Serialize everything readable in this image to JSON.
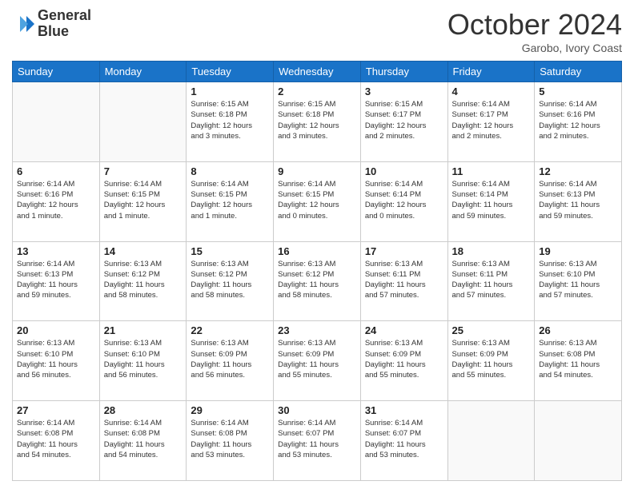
{
  "header": {
    "logo_line1": "General",
    "logo_line2": "Blue",
    "month": "October 2024",
    "location": "Garobo, Ivory Coast"
  },
  "weekdays": [
    "Sunday",
    "Monday",
    "Tuesday",
    "Wednesday",
    "Thursday",
    "Friday",
    "Saturday"
  ],
  "weeks": [
    [
      {
        "day": "",
        "info": ""
      },
      {
        "day": "",
        "info": ""
      },
      {
        "day": "1",
        "info": "Sunrise: 6:15 AM\nSunset: 6:18 PM\nDaylight: 12 hours\nand 3 minutes."
      },
      {
        "day": "2",
        "info": "Sunrise: 6:15 AM\nSunset: 6:18 PM\nDaylight: 12 hours\nand 3 minutes."
      },
      {
        "day": "3",
        "info": "Sunrise: 6:15 AM\nSunset: 6:17 PM\nDaylight: 12 hours\nand 2 minutes."
      },
      {
        "day": "4",
        "info": "Sunrise: 6:14 AM\nSunset: 6:17 PM\nDaylight: 12 hours\nand 2 minutes."
      },
      {
        "day": "5",
        "info": "Sunrise: 6:14 AM\nSunset: 6:16 PM\nDaylight: 12 hours\nand 2 minutes."
      }
    ],
    [
      {
        "day": "6",
        "info": "Sunrise: 6:14 AM\nSunset: 6:16 PM\nDaylight: 12 hours\nand 1 minute."
      },
      {
        "day": "7",
        "info": "Sunrise: 6:14 AM\nSunset: 6:15 PM\nDaylight: 12 hours\nand 1 minute."
      },
      {
        "day": "8",
        "info": "Sunrise: 6:14 AM\nSunset: 6:15 PM\nDaylight: 12 hours\nand 1 minute."
      },
      {
        "day": "9",
        "info": "Sunrise: 6:14 AM\nSunset: 6:15 PM\nDaylight: 12 hours\nand 0 minutes."
      },
      {
        "day": "10",
        "info": "Sunrise: 6:14 AM\nSunset: 6:14 PM\nDaylight: 12 hours\nand 0 minutes."
      },
      {
        "day": "11",
        "info": "Sunrise: 6:14 AM\nSunset: 6:14 PM\nDaylight: 11 hours\nand 59 minutes."
      },
      {
        "day": "12",
        "info": "Sunrise: 6:14 AM\nSunset: 6:13 PM\nDaylight: 11 hours\nand 59 minutes."
      }
    ],
    [
      {
        "day": "13",
        "info": "Sunrise: 6:14 AM\nSunset: 6:13 PM\nDaylight: 11 hours\nand 59 minutes."
      },
      {
        "day": "14",
        "info": "Sunrise: 6:13 AM\nSunset: 6:12 PM\nDaylight: 11 hours\nand 58 minutes."
      },
      {
        "day": "15",
        "info": "Sunrise: 6:13 AM\nSunset: 6:12 PM\nDaylight: 11 hours\nand 58 minutes."
      },
      {
        "day": "16",
        "info": "Sunrise: 6:13 AM\nSunset: 6:12 PM\nDaylight: 11 hours\nand 58 minutes."
      },
      {
        "day": "17",
        "info": "Sunrise: 6:13 AM\nSunset: 6:11 PM\nDaylight: 11 hours\nand 57 minutes."
      },
      {
        "day": "18",
        "info": "Sunrise: 6:13 AM\nSunset: 6:11 PM\nDaylight: 11 hours\nand 57 minutes."
      },
      {
        "day": "19",
        "info": "Sunrise: 6:13 AM\nSunset: 6:10 PM\nDaylight: 11 hours\nand 57 minutes."
      }
    ],
    [
      {
        "day": "20",
        "info": "Sunrise: 6:13 AM\nSunset: 6:10 PM\nDaylight: 11 hours\nand 56 minutes."
      },
      {
        "day": "21",
        "info": "Sunrise: 6:13 AM\nSunset: 6:10 PM\nDaylight: 11 hours\nand 56 minutes."
      },
      {
        "day": "22",
        "info": "Sunrise: 6:13 AM\nSunset: 6:09 PM\nDaylight: 11 hours\nand 56 minutes."
      },
      {
        "day": "23",
        "info": "Sunrise: 6:13 AM\nSunset: 6:09 PM\nDaylight: 11 hours\nand 55 minutes."
      },
      {
        "day": "24",
        "info": "Sunrise: 6:13 AM\nSunset: 6:09 PM\nDaylight: 11 hours\nand 55 minutes."
      },
      {
        "day": "25",
        "info": "Sunrise: 6:13 AM\nSunset: 6:09 PM\nDaylight: 11 hours\nand 55 minutes."
      },
      {
        "day": "26",
        "info": "Sunrise: 6:13 AM\nSunset: 6:08 PM\nDaylight: 11 hours\nand 54 minutes."
      }
    ],
    [
      {
        "day": "27",
        "info": "Sunrise: 6:14 AM\nSunset: 6:08 PM\nDaylight: 11 hours\nand 54 minutes."
      },
      {
        "day": "28",
        "info": "Sunrise: 6:14 AM\nSunset: 6:08 PM\nDaylight: 11 hours\nand 54 minutes."
      },
      {
        "day": "29",
        "info": "Sunrise: 6:14 AM\nSunset: 6:08 PM\nDaylight: 11 hours\nand 53 minutes."
      },
      {
        "day": "30",
        "info": "Sunrise: 6:14 AM\nSunset: 6:07 PM\nDaylight: 11 hours\nand 53 minutes."
      },
      {
        "day": "31",
        "info": "Sunrise: 6:14 AM\nSunset: 6:07 PM\nDaylight: 11 hours\nand 53 minutes."
      },
      {
        "day": "",
        "info": ""
      },
      {
        "day": "",
        "info": ""
      }
    ]
  ]
}
